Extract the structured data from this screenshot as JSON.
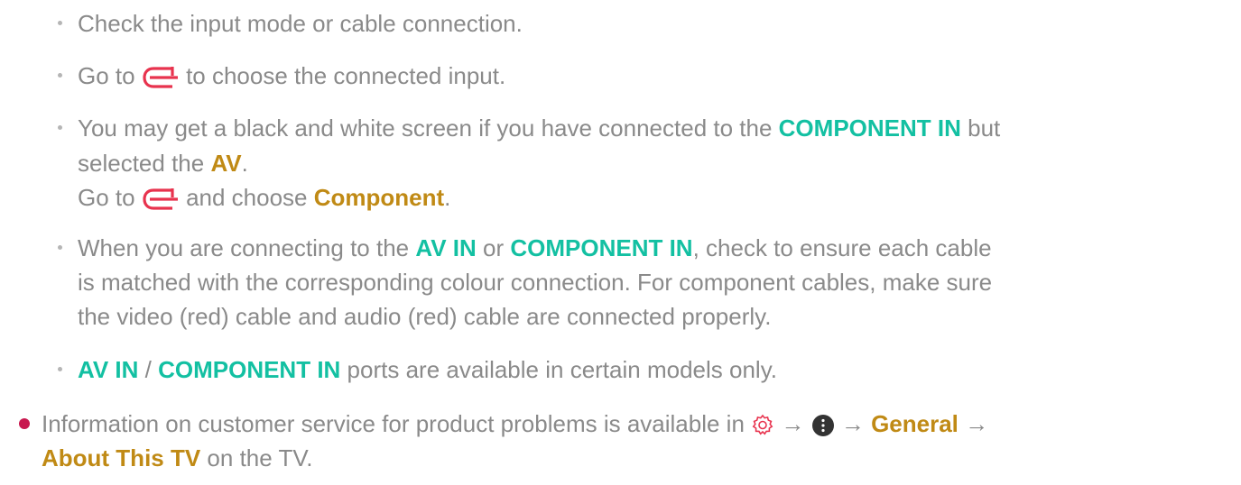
{
  "colors": {
    "text": "#8a8a8a",
    "teal": "#13c0a2",
    "gold": "#c08a15",
    "input_icon": "#e8334e",
    "top_bullet": "#c8174e"
  },
  "b1": {
    "text": "Check the input mode or cable connection."
  },
  "b2": {
    "pre": "Go to ",
    "icon": "input-icon",
    "post": " to choose the connected input."
  },
  "b3": {
    "l1_pre": "You may get a black and white screen if you have connected to the ",
    "l1_hl": "COMPONENT IN",
    "l1_post": " but",
    "l2_pre": "selected the ",
    "l2_hl": "AV",
    "l2_post": ".",
    "l3_pre": "Go to ",
    "l3_icon": "input-icon",
    "l3_mid": " and choose ",
    "l3_hl": "Component",
    "l3_post": "."
  },
  "b4": {
    "l1_pre": "When you are connecting to the ",
    "l1_hl1": "AV IN",
    "l1_mid": " or ",
    "l1_hl2": "COMPONENT IN",
    "l1_post": ", check to ensure each cable",
    "l2": "is matched with the corresponding colour connection. For component cables, make sure",
    "l3": "the video (red) cable and audio (red) cable are connected properly."
  },
  "b5": {
    "hl1": "AV IN",
    "sep": " / ",
    "hl2": "COMPONENT IN",
    "post": " ports are available in certain models only."
  },
  "info": {
    "l1_pre": "Information on customer service for product problems is available in ",
    "icons": [
      "settings-gear-icon",
      "more-menu-icon"
    ],
    "arrow": "→",
    "hl1": "General",
    "l2_hl": "About This TV",
    "l2_post": " on the TV."
  }
}
